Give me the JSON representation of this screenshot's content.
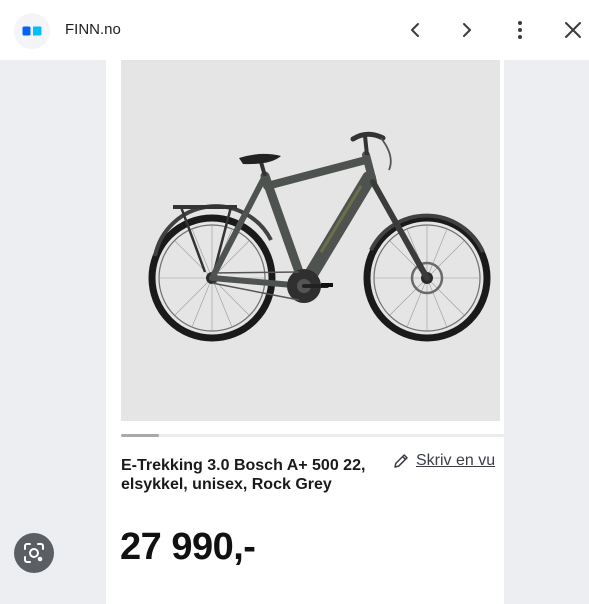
{
  "header": {
    "site_name": "FINN.no",
    "brand_color": "#0063fb",
    "favicon": "finn-logo-icon",
    "back_icon": "chevron-left-icon",
    "forward_icon": "chevron-right-icon",
    "menu_icon": "more-vertical-icon",
    "close_icon": "close-icon"
  },
  "listing": {
    "title": "E-Trekking 3.0 Bosch A+ 500 22, elsykkel, unisex, Rock Grey",
    "write_link": "Skriv en vu",
    "write_icon": "pencil-icon",
    "price": "27 990,-"
  },
  "photo": {
    "subject": "bicycle-image",
    "carousel_position": 0.1
  },
  "lens": {
    "icon": "lens-search-icon"
  }
}
